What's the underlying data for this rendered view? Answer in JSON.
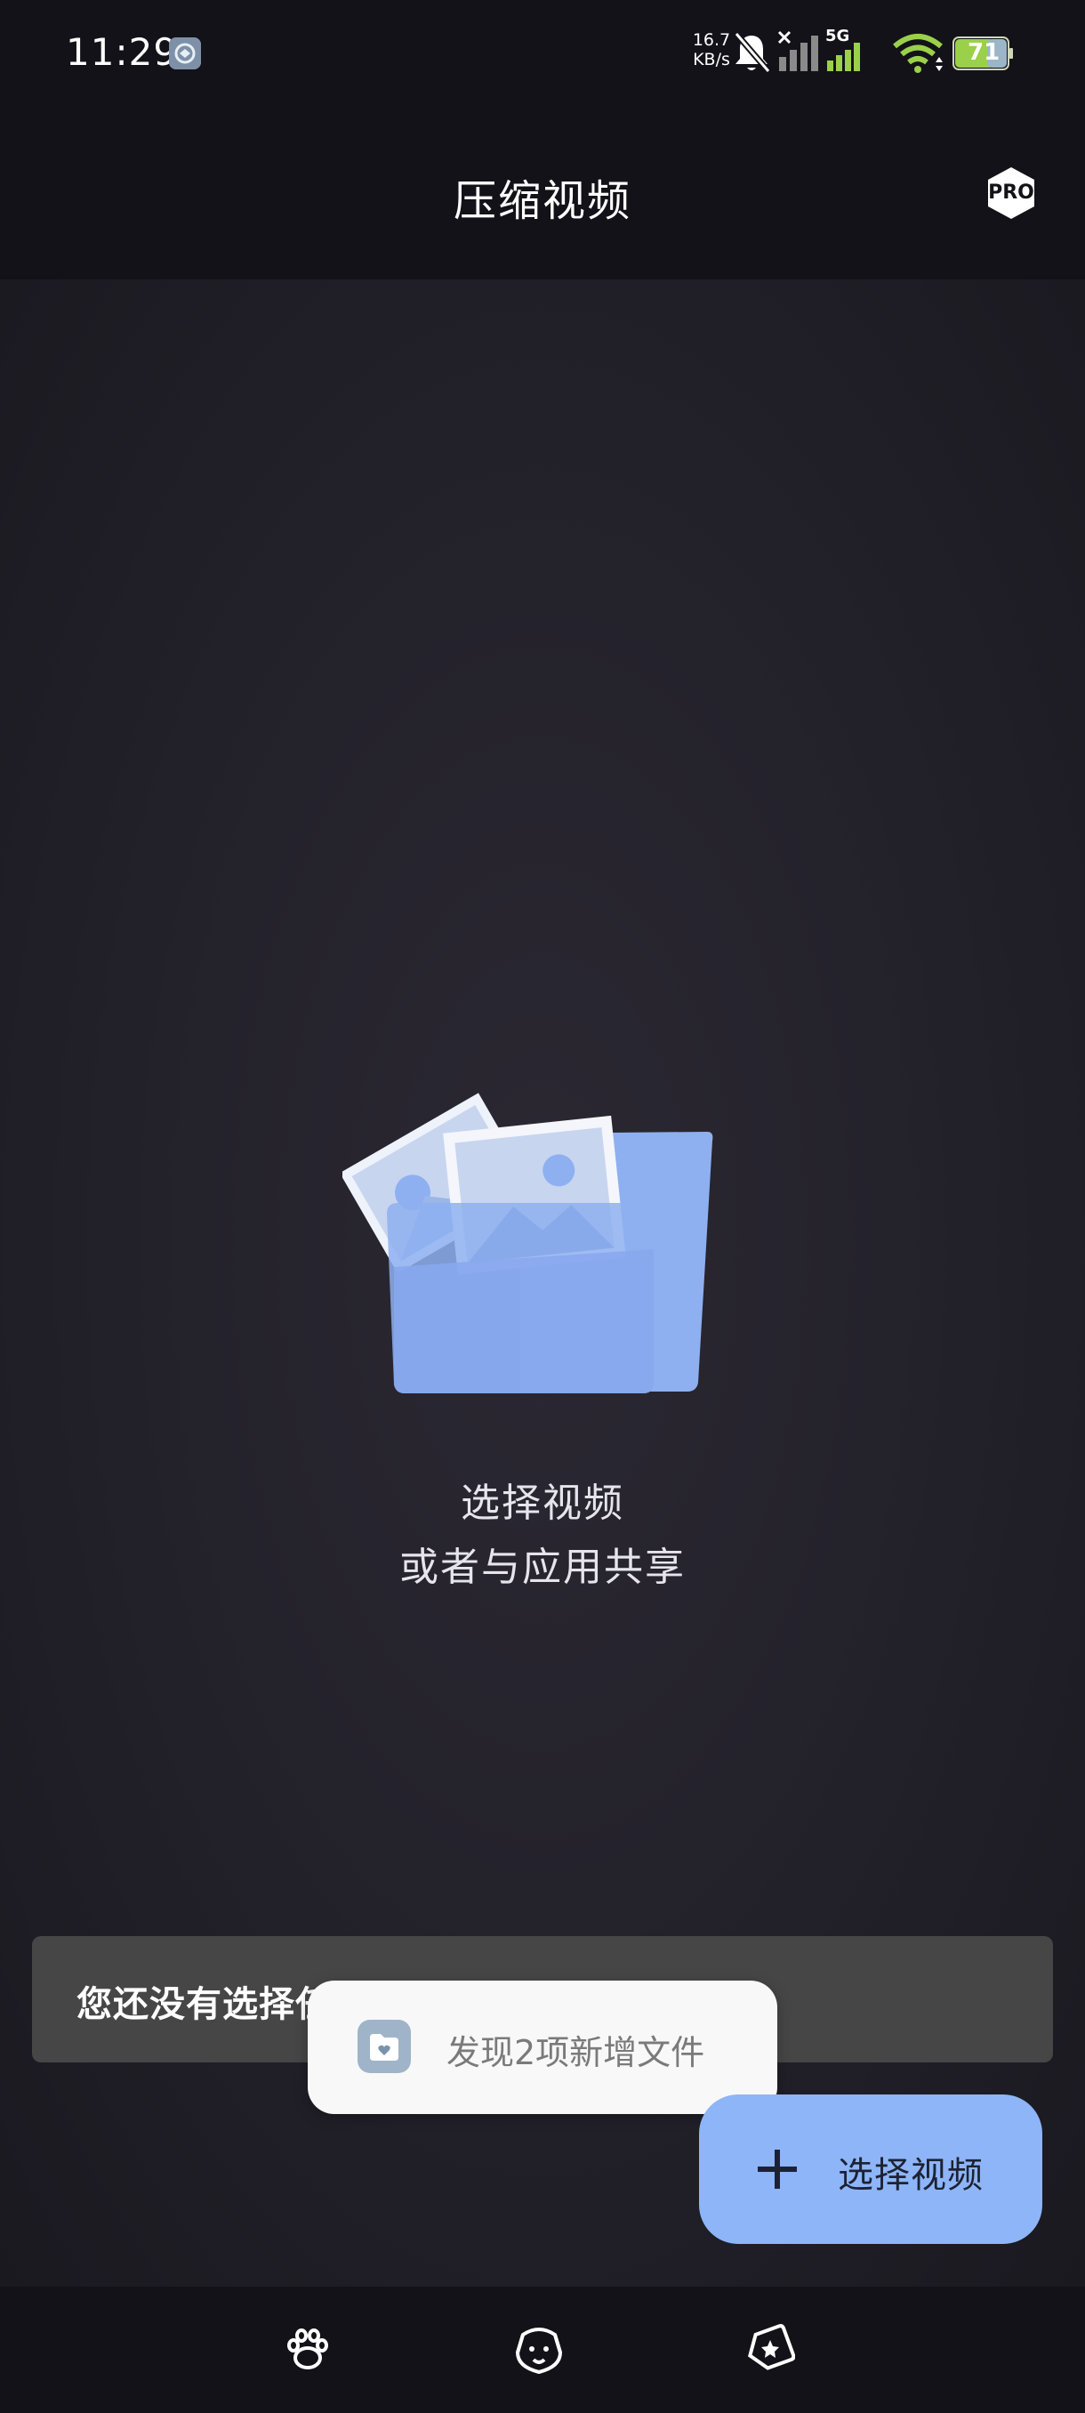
{
  "status_bar": {
    "time": "11:29",
    "net_speed_value": "16.7",
    "net_speed_unit": "KB/s",
    "network_type": "5G",
    "battery": "71",
    "icons": [
      "app-notification-icon",
      "bell-muted-icon",
      "signal-no-service-icon",
      "signal-5g-icon",
      "wifi-icon",
      "battery-icon"
    ]
  },
  "app_bar": {
    "title": "压缩视频",
    "pro_label": "PRO"
  },
  "empty_state": {
    "line1": "选择视频",
    "line2": "或者与应用共享",
    "illustration": "folder-with-photos-icon"
  },
  "snackbar": {
    "text": "您还没有选择任何视频"
  },
  "toast": {
    "text": "发现2项新增文件",
    "icon": "folder-heart-icon"
  },
  "fab": {
    "label": "选择视频",
    "icon": "plus-icon"
  },
  "nav_bar": {
    "icons": [
      "paw-icon",
      "dog-face-icon",
      "star-tag-icon"
    ]
  },
  "colors": {
    "background": "#131218",
    "accent": "#8db5f8",
    "snackbar": "#464646",
    "toast": "#f8f8f8"
  }
}
